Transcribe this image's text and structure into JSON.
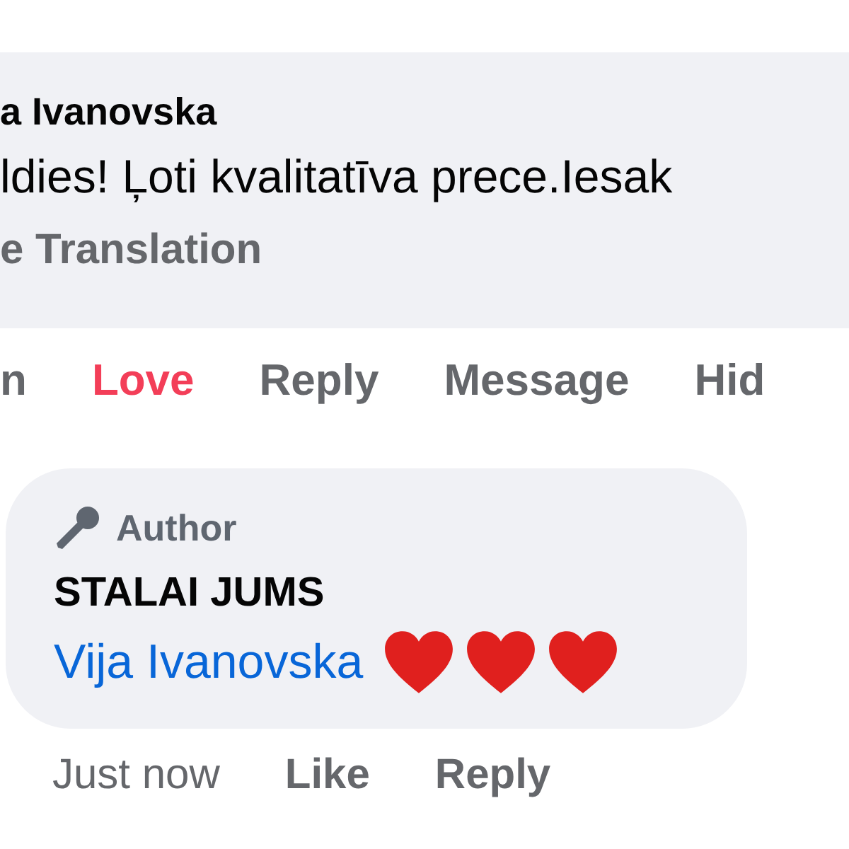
{
  "comment": {
    "author": "a Ivanovska",
    "text": "ldies! Ļoti kvalitatīva prece.Iesak",
    "translation": "e Translation"
  },
  "comment_actions": [
    {
      "label": "n",
      "selected": false
    },
    {
      "label": "Love",
      "selected": true
    },
    {
      "label": "Reply",
      "selected": false
    },
    {
      "label": "Message",
      "selected": false
    },
    {
      "label": "Hid",
      "selected": false
    }
  ],
  "reply": {
    "badge": "Author",
    "text": "STALAI JUMS",
    "mention": "Vija Ivanovska",
    "emojis": [
      {
        "kind": "heart"
      },
      {
        "kind": "heart"
      },
      {
        "kind": "heart"
      }
    ],
    "time": "Just now",
    "actions": [
      "Like",
      "Reply"
    ]
  }
}
